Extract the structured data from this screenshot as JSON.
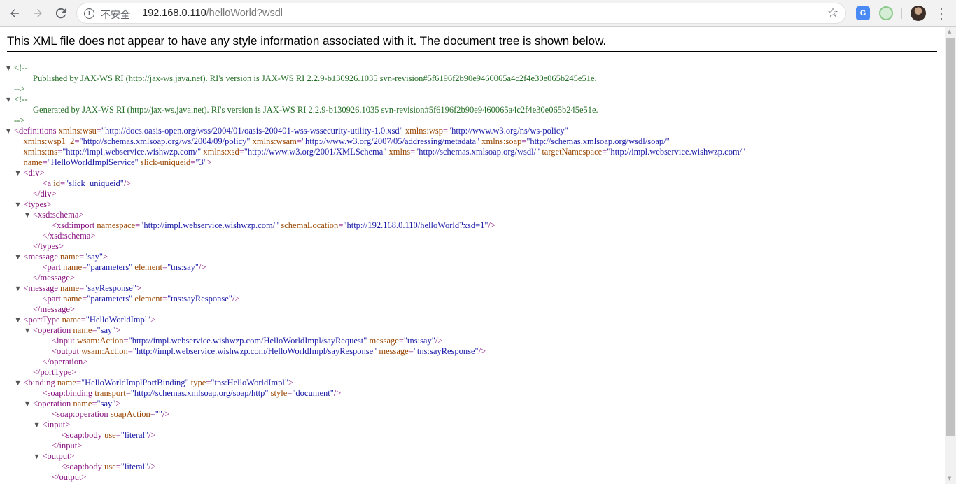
{
  "browser": {
    "back_icon": "back-arrow-icon",
    "forward_icon": "forward-arrow-icon",
    "reload_icon": "reload-icon",
    "security_label": "不安全",
    "url_host": "192.168.0.110",
    "url_path": "/helloWorld?wsdl",
    "translate_label": "G"
  },
  "page": {
    "message": "This XML file does not appear to have any style information associated with it. The document tree is shown below."
  },
  "tree": [
    {
      "toggle": true,
      "indent": 0,
      "parts": [
        {
          "c": "cmt",
          "t": "<!--"
        }
      ]
    },
    {
      "indent": 2,
      "parts": [
        {
          "c": "cmt",
          "t": "Published by JAX-WS RI (http://jax-ws.java.net). RI's version is JAX-WS RI 2.2.9-b130926.1035 svn-revision#5f6196f2b90e9460065a4c2f4e30e065b245e51e."
        }
      ]
    },
    {
      "indent": 0,
      "parts": [
        {
          "c": "cmt",
          "t": "-->"
        }
      ]
    },
    {
      "toggle": true,
      "indent": 0,
      "parts": [
        {
          "c": "cmt",
          "t": "<!--"
        }
      ]
    },
    {
      "indent": 2,
      "parts": [
        {
          "c": "cmt",
          "t": "Generated by JAX-WS RI (http://jax-ws.java.net). RI's version is JAX-WS RI 2.2.9-b130926.1035 svn-revision#5f6196f2b90e9460065a4c2f4e30e065b245e51e."
        }
      ]
    },
    {
      "indent": 0,
      "parts": [
        {
          "c": "cmt",
          "t": "-->"
        }
      ]
    },
    {
      "toggle": true,
      "indent": 0,
      "parts": [
        {
          "c": "tag",
          "t": "<definitions"
        },
        {
          "c": "attr",
          "t": " xmlns:wsu"
        },
        {
          "c": "tag",
          "t": "="
        },
        {
          "c": "val",
          "t": "\"http://docs.oasis-open.org/wss/2004/01/oasis-200401-wss-wssecurity-utility-1.0.xsd\""
        },
        {
          "c": "attr",
          "t": " xmlns:wsp"
        },
        {
          "c": "tag",
          "t": "="
        },
        {
          "c": "val",
          "t": "\"http://www.w3.org/ns/ws-policy\""
        }
      ]
    },
    {
      "indent": 1,
      "parts": [
        {
          "c": "attr",
          "t": "xmlns:wsp1_2"
        },
        {
          "c": "tag",
          "t": "="
        },
        {
          "c": "val",
          "t": "\"http://schemas.xmlsoap.org/ws/2004/09/policy\""
        },
        {
          "c": "attr",
          "t": " xmlns:wsam"
        },
        {
          "c": "tag",
          "t": "="
        },
        {
          "c": "val",
          "t": "\"http://www.w3.org/2007/05/addressing/metadata\""
        },
        {
          "c": "attr",
          "t": " xmlns:soap"
        },
        {
          "c": "tag",
          "t": "="
        },
        {
          "c": "val",
          "t": "\"http://schemas.xmlsoap.org/wsdl/soap/\""
        }
      ]
    },
    {
      "indent": 1,
      "parts": [
        {
          "c": "attr",
          "t": "xmlns:tns"
        },
        {
          "c": "tag",
          "t": "="
        },
        {
          "c": "val",
          "t": "\"http://impl.webservice.wishwzp.com/\""
        },
        {
          "c": "attr",
          "t": " xmlns:xsd"
        },
        {
          "c": "tag",
          "t": "="
        },
        {
          "c": "val",
          "t": "\"http://www.w3.org/2001/XMLSchema\""
        },
        {
          "c": "attr",
          "t": " xmlns"
        },
        {
          "c": "tag",
          "t": "="
        },
        {
          "c": "val",
          "t": "\"http://schemas.xmlsoap.org/wsdl/\""
        },
        {
          "c": "attr",
          "t": " targetNamespace"
        },
        {
          "c": "tag",
          "t": "="
        },
        {
          "c": "val",
          "t": "\"http://impl.webservice.wishwzp.com/\""
        }
      ]
    },
    {
      "indent": 1,
      "parts": [
        {
          "c": "attr",
          "t": "name"
        },
        {
          "c": "tag",
          "t": "="
        },
        {
          "c": "val",
          "t": "\"HelloWorldImplService\""
        },
        {
          "c": "attr",
          "t": " slick-uniqueid"
        },
        {
          "c": "tag",
          "t": "="
        },
        {
          "c": "val",
          "t": "\"3\""
        },
        {
          "c": "tag",
          "t": ">"
        }
      ]
    },
    {
      "toggle": true,
      "indent": 1,
      "parts": [
        {
          "c": "tag",
          "t": "<div>"
        }
      ]
    },
    {
      "indent": 3,
      "parts": [
        {
          "c": "tag",
          "t": "<a"
        },
        {
          "c": "attr",
          "t": " id"
        },
        {
          "c": "tag",
          "t": "="
        },
        {
          "c": "val",
          "t": "\"slick_uniqueid\""
        },
        {
          "c": "tag",
          "t": "/>"
        }
      ]
    },
    {
      "indent": 2,
      "parts": [
        {
          "c": "tag",
          "t": "</div>"
        }
      ]
    },
    {
      "toggle": true,
      "indent": 1,
      "parts": [
        {
          "c": "tag",
          "t": "<types>"
        }
      ]
    },
    {
      "toggle": true,
      "indent": 2,
      "parts": [
        {
          "c": "tag",
          "t": "<xsd:schema>"
        }
      ]
    },
    {
      "indent": 4,
      "parts": [
        {
          "c": "tag",
          "t": "<xsd:import"
        },
        {
          "c": "attr",
          "t": " namespace"
        },
        {
          "c": "tag",
          "t": "="
        },
        {
          "c": "val",
          "t": "\"http://impl.webservice.wishwzp.com/\""
        },
        {
          "c": "attr",
          "t": " schemaLocation"
        },
        {
          "c": "tag",
          "t": "="
        },
        {
          "c": "val",
          "t": "\"http://192.168.0.110/helloWorld?xsd=1\""
        },
        {
          "c": "tag",
          "t": "/>"
        }
      ]
    },
    {
      "indent": 3,
      "parts": [
        {
          "c": "tag",
          "t": "</xsd:schema>"
        }
      ]
    },
    {
      "indent": 2,
      "parts": [
        {
          "c": "tag",
          "t": "</types>"
        }
      ]
    },
    {
      "toggle": true,
      "indent": 1,
      "parts": [
        {
          "c": "tag",
          "t": "<message"
        },
        {
          "c": "attr",
          "t": " name"
        },
        {
          "c": "tag",
          "t": "="
        },
        {
          "c": "val",
          "t": "\"say\""
        },
        {
          "c": "tag",
          "t": ">"
        }
      ]
    },
    {
      "indent": 3,
      "parts": [
        {
          "c": "tag",
          "t": "<part"
        },
        {
          "c": "attr",
          "t": " name"
        },
        {
          "c": "tag",
          "t": "="
        },
        {
          "c": "val",
          "t": "\"parameters\""
        },
        {
          "c": "attr",
          "t": " element"
        },
        {
          "c": "tag",
          "t": "="
        },
        {
          "c": "val",
          "t": "\"tns:say\""
        },
        {
          "c": "tag",
          "t": "/>"
        }
      ]
    },
    {
      "indent": 2,
      "parts": [
        {
          "c": "tag",
          "t": "</message>"
        }
      ]
    },
    {
      "toggle": true,
      "indent": 1,
      "parts": [
        {
          "c": "tag",
          "t": "<message"
        },
        {
          "c": "attr",
          "t": " name"
        },
        {
          "c": "tag",
          "t": "="
        },
        {
          "c": "val",
          "t": "\"sayResponse\""
        },
        {
          "c": "tag",
          "t": ">"
        }
      ]
    },
    {
      "indent": 3,
      "parts": [
        {
          "c": "tag",
          "t": "<part"
        },
        {
          "c": "attr",
          "t": " name"
        },
        {
          "c": "tag",
          "t": "="
        },
        {
          "c": "val",
          "t": "\"parameters\""
        },
        {
          "c": "attr",
          "t": " element"
        },
        {
          "c": "tag",
          "t": "="
        },
        {
          "c": "val",
          "t": "\"tns:sayResponse\""
        },
        {
          "c": "tag",
          "t": "/>"
        }
      ]
    },
    {
      "indent": 2,
      "parts": [
        {
          "c": "tag",
          "t": "</message>"
        }
      ]
    },
    {
      "toggle": true,
      "indent": 1,
      "parts": [
        {
          "c": "tag",
          "t": "<portType"
        },
        {
          "c": "attr",
          "t": " name"
        },
        {
          "c": "tag",
          "t": "="
        },
        {
          "c": "val",
          "t": "\"HelloWorldImpl\""
        },
        {
          "c": "tag",
          "t": ">"
        }
      ]
    },
    {
      "toggle": true,
      "indent": 2,
      "parts": [
        {
          "c": "tag",
          "t": "<operation"
        },
        {
          "c": "attr",
          "t": " name"
        },
        {
          "c": "tag",
          "t": "="
        },
        {
          "c": "val",
          "t": "\"say\""
        },
        {
          "c": "tag",
          "t": ">"
        }
      ]
    },
    {
      "indent": 4,
      "parts": [
        {
          "c": "tag",
          "t": "<input"
        },
        {
          "c": "attr",
          "t": " wsam:Action"
        },
        {
          "c": "tag",
          "t": "="
        },
        {
          "c": "val",
          "t": "\"http://impl.webservice.wishwzp.com/HelloWorldImpl/sayRequest\""
        },
        {
          "c": "attr",
          "t": " message"
        },
        {
          "c": "tag",
          "t": "="
        },
        {
          "c": "val",
          "t": "\"tns:say\""
        },
        {
          "c": "tag",
          "t": "/>"
        }
      ]
    },
    {
      "indent": 4,
      "parts": [
        {
          "c": "tag",
          "t": "<output"
        },
        {
          "c": "attr",
          "t": " wsam:Action"
        },
        {
          "c": "tag",
          "t": "="
        },
        {
          "c": "val",
          "t": "\"http://impl.webservice.wishwzp.com/HelloWorldImpl/sayResponse\""
        },
        {
          "c": "attr",
          "t": " message"
        },
        {
          "c": "tag",
          "t": "="
        },
        {
          "c": "val",
          "t": "\"tns:sayResponse\""
        },
        {
          "c": "tag",
          "t": "/>"
        }
      ]
    },
    {
      "indent": 3,
      "parts": [
        {
          "c": "tag",
          "t": "</operation>"
        }
      ]
    },
    {
      "indent": 2,
      "parts": [
        {
          "c": "tag",
          "t": "</portType>"
        }
      ]
    },
    {
      "toggle": true,
      "indent": 1,
      "parts": [
        {
          "c": "tag",
          "t": "<binding"
        },
        {
          "c": "attr",
          "t": " name"
        },
        {
          "c": "tag",
          "t": "="
        },
        {
          "c": "val",
          "t": "\"HelloWorldImplPortBinding\""
        },
        {
          "c": "attr",
          "t": " type"
        },
        {
          "c": "tag",
          "t": "="
        },
        {
          "c": "val",
          "t": "\"tns:HelloWorldImpl\""
        },
        {
          "c": "tag",
          "t": ">"
        }
      ]
    },
    {
      "indent": 3,
      "parts": [
        {
          "c": "tag",
          "t": "<soap:binding"
        },
        {
          "c": "attr",
          "t": " transport"
        },
        {
          "c": "tag",
          "t": "="
        },
        {
          "c": "val",
          "t": "\"http://schemas.xmlsoap.org/soap/http\""
        },
        {
          "c": "attr",
          "t": " style"
        },
        {
          "c": "tag",
          "t": "="
        },
        {
          "c": "val",
          "t": "\"document\""
        },
        {
          "c": "tag",
          "t": "/>"
        }
      ]
    },
    {
      "toggle": true,
      "indent": 2,
      "parts": [
        {
          "c": "tag",
          "t": "<operation"
        },
        {
          "c": "attr",
          "t": " name"
        },
        {
          "c": "tag",
          "t": "="
        },
        {
          "c": "val",
          "t": "\"say\""
        },
        {
          "c": "tag",
          "t": ">"
        }
      ]
    },
    {
      "indent": 4,
      "parts": [
        {
          "c": "tag",
          "t": "<soap:operation"
        },
        {
          "c": "attr",
          "t": " soapAction"
        },
        {
          "c": "tag",
          "t": "="
        },
        {
          "c": "val",
          "t": "\"\""
        },
        {
          "c": "tag",
          "t": "/>"
        }
      ]
    },
    {
      "toggle": true,
      "indent": 3,
      "parts": [
        {
          "c": "tag",
          "t": "<input>"
        }
      ]
    },
    {
      "indent": 5,
      "parts": [
        {
          "c": "tag",
          "t": "<soap:body"
        },
        {
          "c": "attr",
          "t": " use"
        },
        {
          "c": "tag",
          "t": "="
        },
        {
          "c": "val",
          "t": "\"literal\""
        },
        {
          "c": "tag",
          "t": "/>"
        }
      ]
    },
    {
      "indent": 4,
      "parts": [
        {
          "c": "tag",
          "t": "</input>"
        }
      ]
    },
    {
      "toggle": true,
      "indent": 3,
      "parts": [
        {
          "c": "tag",
          "t": "<output>"
        }
      ]
    },
    {
      "indent": 5,
      "parts": [
        {
          "c": "tag",
          "t": "<soap:body"
        },
        {
          "c": "attr",
          "t": " use"
        },
        {
          "c": "tag",
          "t": "="
        },
        {
          "c": "val",
          "t": "\"literal\""
        },
        {
          "c": "tag",
          "t": "/>"
        }
      ]
    },
    {
      "indent": 4,
      "parts": [
        {
          "c": "tag",
          "t": "</output>"
        }
      ]
    }
  ]
}
